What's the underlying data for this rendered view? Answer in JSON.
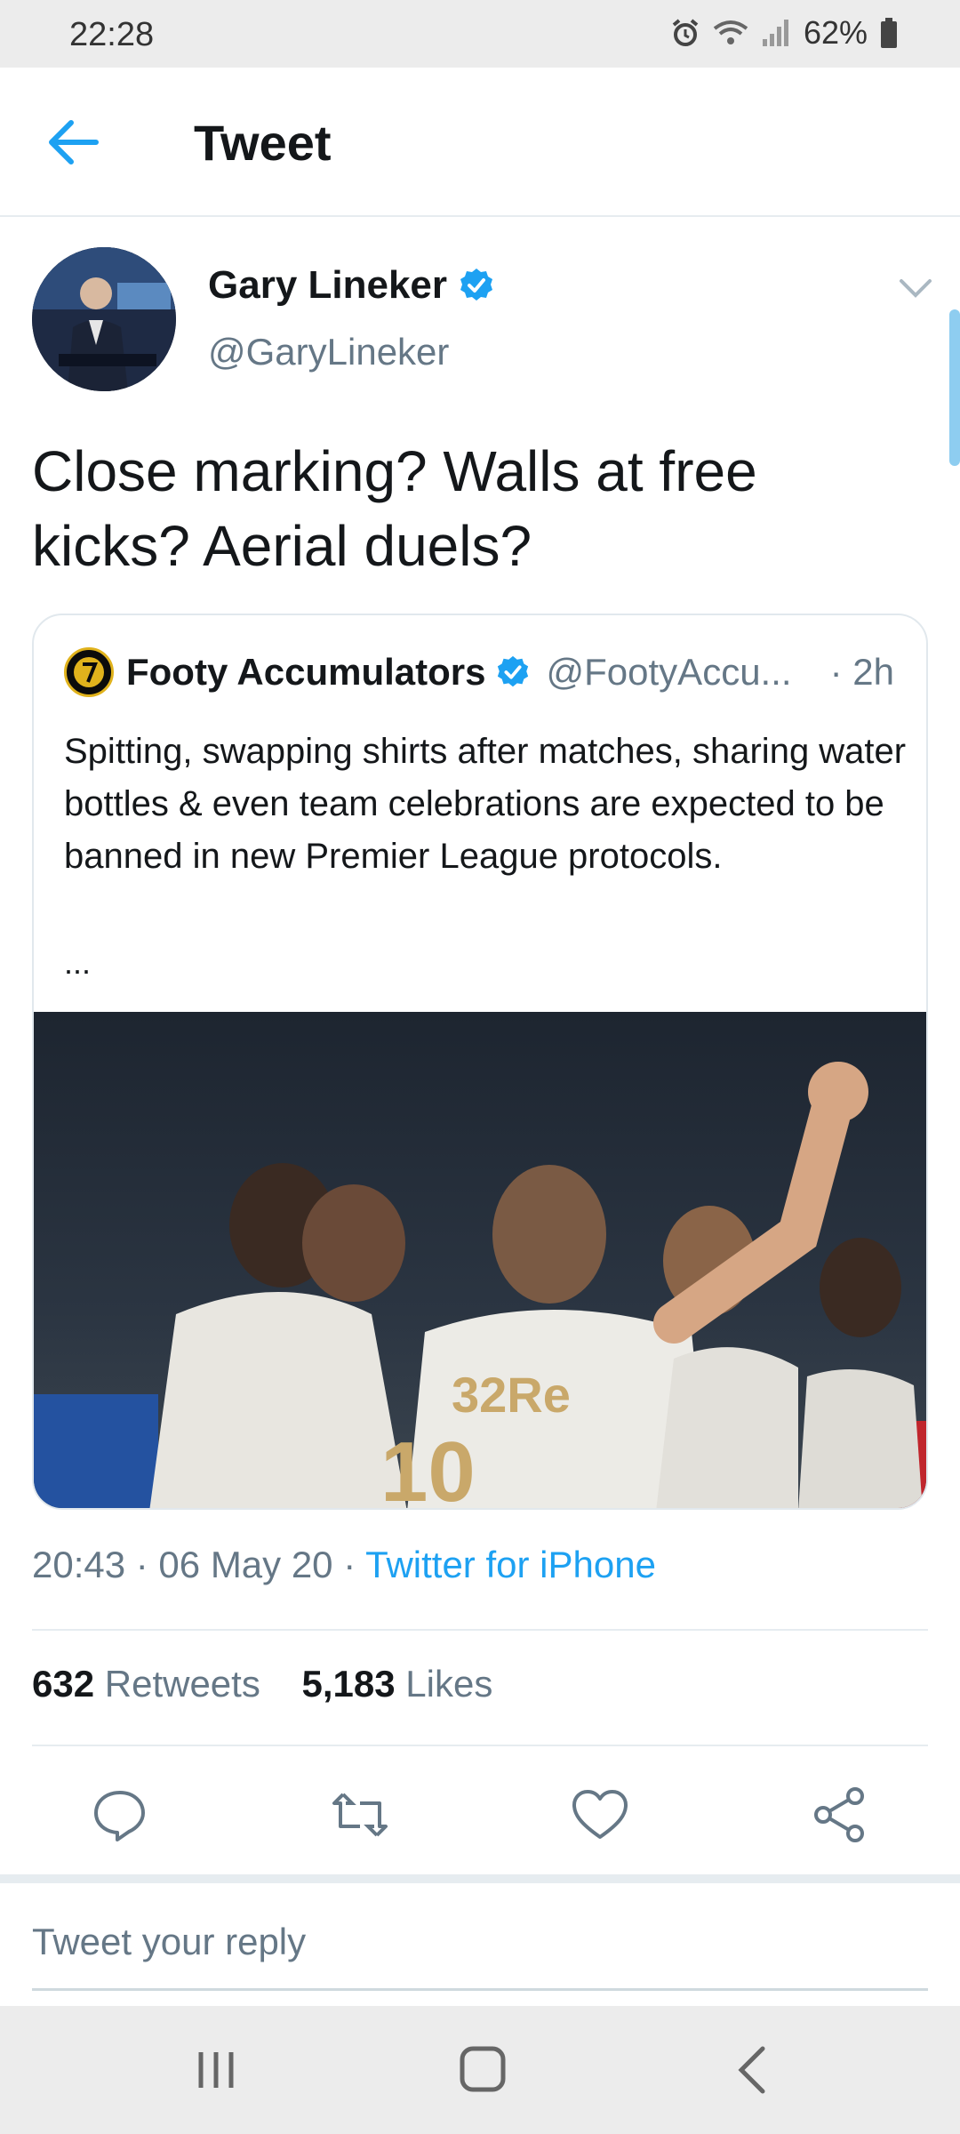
{
  "status_bar": {
    "time": "22:28",
    "battery": "62%",
    "icons": [
      "alarm-icon",
      "wifi-icon",
      "signal-icon",
      "battery-icon"
    ]
  },
  "header": {
    "title": "Tweet",
    "back_icon": "arrow-left-icon"
  },
  "tweet": {
    "author_name": "Gary Lineker",
    "author_handle": "@GaryLineker",
    "text": "Close marking? Walls at free kicks? Aerial duels?",
    "timestamp": "20:43 · 06 May 20 · ",
    "source": "Twitter for iPhone",
    "retweets_count": "632",
    "retweets_label": "Retweets",
    "likes_count": "5,183",
    "likes_label": "Likes"
  },
  "quoted_tweet": {
    "author_name": "Footy Accumulators",
    "author_handle": "@FootyAccu...",
    "time": "· 2h",
    "text": "Spitting, swapping shirts after matches, sharing water bottles & even team celebrations are expected to be banned in new Premier League protocols.",
    "more": "..."
  },
  "reply": {
    "placeholder": "Tweet your reply"
  },
  "colors": {
    "accent": "#1da1f2",
    "secondary_text": "#657786",
    "verified": "#1da1f2"
  }
}
